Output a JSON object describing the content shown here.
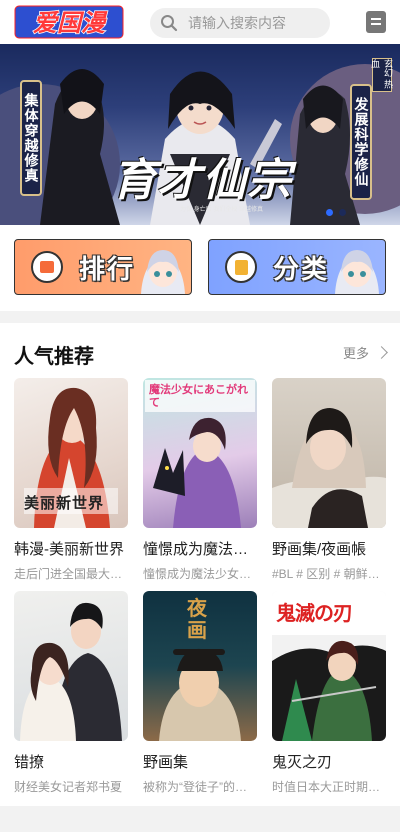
{
  "header": {
    "logo_text": "爱国漫",
    "search_placeholder": "请输入搜索内容",
    "history_icon": "history-book-icon"
  },
  "banner": {
    "title": "育才仙宗",
    "left_scroll": "集体穿越修真",
    "right_scroll": "发展科学修仙",
    "tag": "玄幻 热血",
    "subtitle": "为保 身亡后 我们全校 穿越修真",
    "active_dot": 0,
    "dot_count": 2
  },
  "entries": [
    {
      "label": "排行",
      "icon": "rank-podium-icon",
      "color": "#ff9c6b"
    },
    {
      "label": "分类",
      "icon": "category-book-icon",
      "color": "#7fa2ff"
    }
  ],
  "popular": {
    "title": "人气推荐",
    "more_label": "更多",
    "items": [
      {
        "name": "韩漫-美丽新世界",
        "desc": "走后门进全国最大企业",
        "cover_text": "美丽新世界"
      },
      {
        "name": "憧憬成为魔法少女",
        "desc": "憧憬成为魔法少女的少女",
        "cover_text": "魔法少女にあこがれて"
      },
      {
        "name": "野画集/夜画帳",
        "desc": "#BL # 区别 # 朝鲜时代",
        "cover_text": ""
      },
      {
        "name": "错撩",
        "desc": "财经美女记者郑书夏",
        "cover_text": ""
      },
      {
        "name": "野画集",
        "desc": "被称为“登徒子”的画师",
        "cover_text": "夜画"
      },
      {
        "name": "鬼灭之刃",
        "desc": "时值日本大正时期，卖炭",
        "cover_text": "鬼滅の刃"
      }
    ]
  }
}
